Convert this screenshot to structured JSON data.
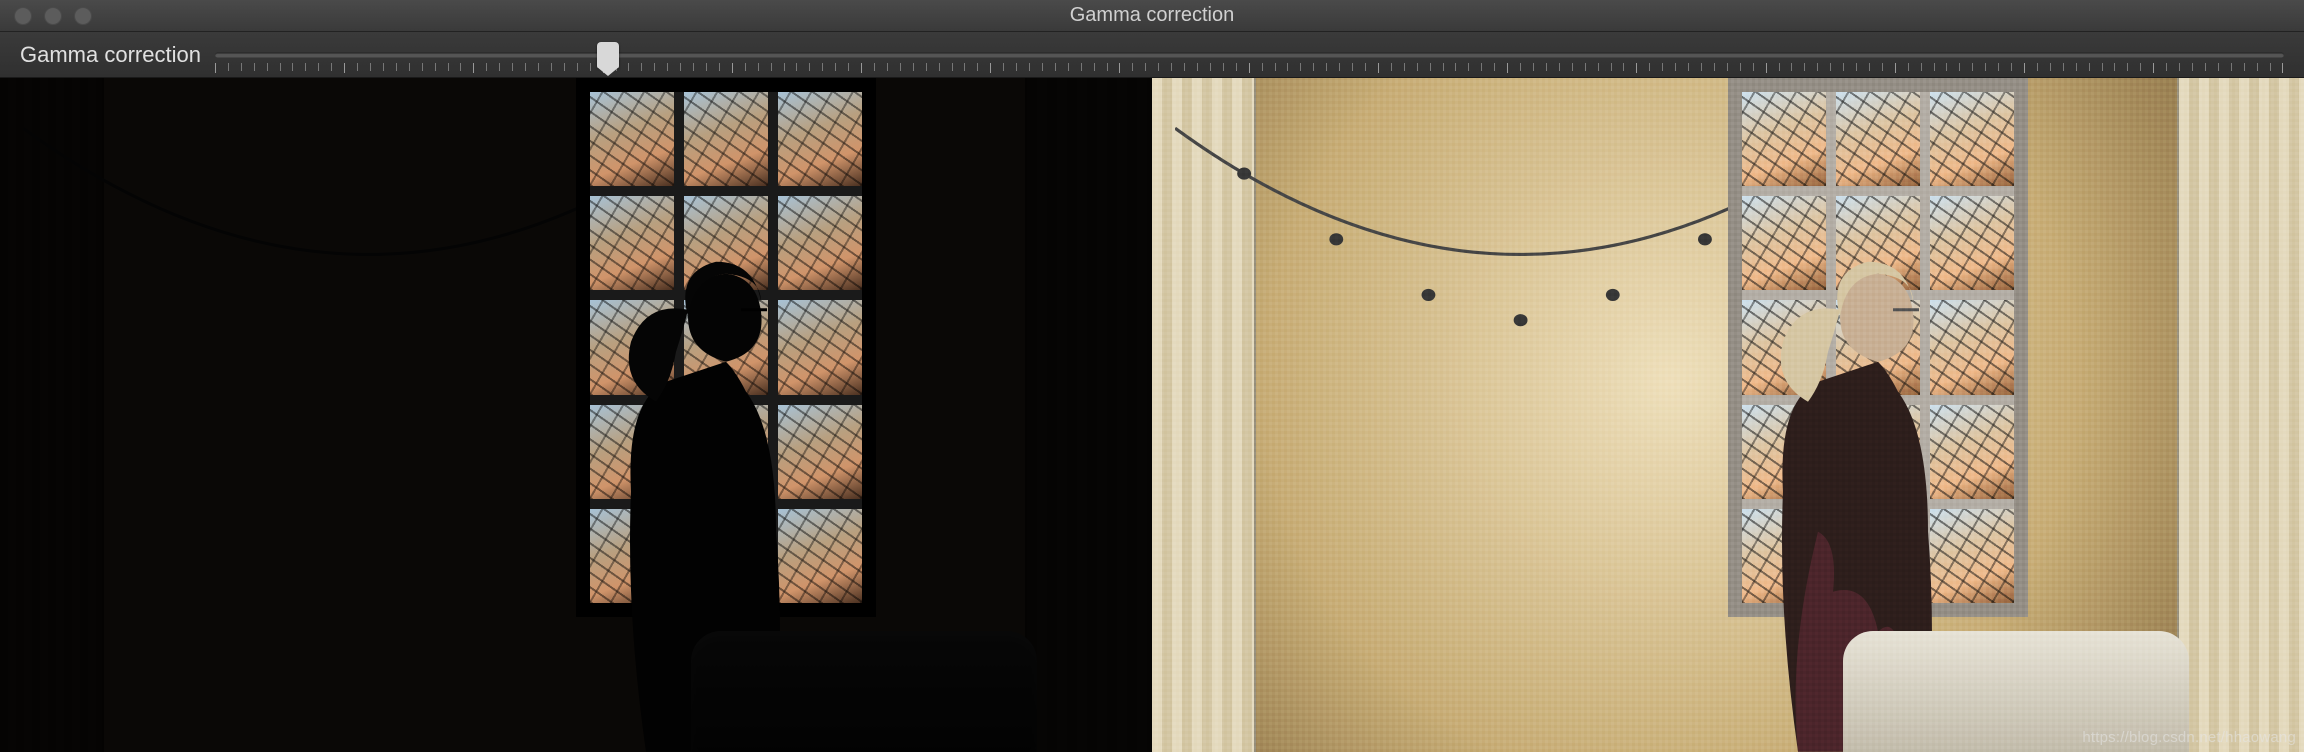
{
  "window": {
    "title": "Gamma correction"
  },
  "slider": {
    "label": "Gamma correction",
    "position_percent": 19,
    "tick_count": 160
  },
  "watermark": "https://blog.csdn.net/hhaowang"
}
